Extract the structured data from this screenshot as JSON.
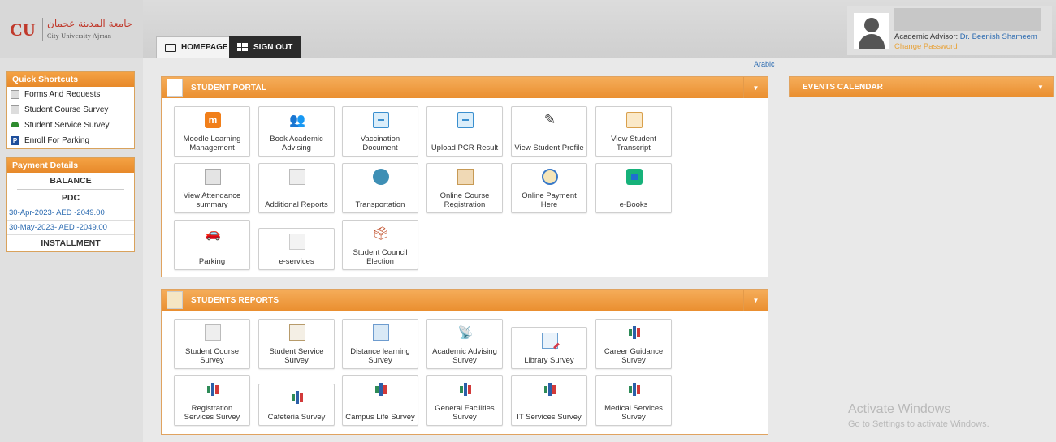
{
  "logo": {
    "abbr": "CU",
    "arabic": "جامعة المدينة عجمان",
    "english": "City University Ajman"
  },
  "tabs": [
    {
      "label": "HOMEPAGE",
      "icon": "monitor-icon"
    },
    {
      "label": "SIGN OUT",
      "icon": "grid-icon"
    }
  ],
  "user": {
    "role_prefix": "Academic Advisor:",
    "advisor": "Dr. Beenish Shameem",
    "change_password": "Change Password"
  },
  "language_link": "Arabic",
  "sidebar": {
    "quick_shortcuts": {
      "title": "Quick Shortcuts",
      "items": [
        {
          "label": "Forms And Requests",
          "icon": "document-icon"
        },
        {
          "label": "Student Course Survey",
          "icon": "survey-icon"
        },
        {
          "label": "Student Service Survey",
          "icon": "service-icon"
        },
        {
          "label": "Enroll For Parking",
          "icon": "parking-icon"
        }
      ]
    },
    "payment": {
      "title": "Payment Details",
      "balance": "BALANCE",
      "pdc": "PDC",
      "entries": [
        "30-Apr-2023- AED -2049.00",
        "30-May-2023- AED -2049.00"
      ],
      "installment": "INSTALLMENT"
    }
  },
  "student_portal": {
    "title": "STUDENT PORTAL",
    "tiles": [
      {
        "label": "Moodle Learning Management",
        "icon": "moodle-icon"
      },
      {
        "label": "Book Academic Advising",
        "icon": "advising-icon"
      },
      {
        "label": "Vaccination Document",
        "icon": "clipboard-icon"
      },
      {
        "label": "Upload PCR Result",
        "icon": "clipboard-icon"
      },
      {
        "label": "View Student Profile",
        "icon": "pencil-icon"
      },
      {
        "label": "View Student Transcript",
        "icon": "transcript-icon"
      },
      {
        "label": "View Attendance summary",
        "icon": "calendar-icon"
      },
      {
        "label": "Additional Reports",
        "icon": "envelope-icon"
      },
      {
        "label": "Transportation",
        "icon": "bus-icon"
      },
      {
        "label": "Online Course Registration",
        "icon": "book-icon"
      },
      {
        "label": "Online Payment Here",
        "icon": "payment-icon"
      },
      {
        "label": "e-Books",
        "icon": "ebook-icon"
      },
      {
        "label": "Parking",
        "icon": "car-icon"
      },
      {
        "label": "e-services",
        "icon": "chart-icon"
      },
      {
        "label": "Student Council Election",
        "icon": "ballot-icon"
      }
    ]
  },
  "students_reports": {
    "title": "STUDENTS REPORTS",
    "tiles": [
      {
        "label": "Student Course Survey",
        "icon": "document-icon"
      },
      {
        "label": "Student Service Survey",
        "icon": "calendar-icon"
      },
      {
        "label": "Distance learning Survey",
        "icon": "banner-icon"
      },
      {
        "label": "Academic Advising Survey",
        "icon": "satellite-icon"
      },
      {
        "label": "Library Survey",
        "icon": "note-icon"
      },
      {
        "label": "Career Guidance Survey",
        "icon": "bar-chart-icon"
      },
      {
        "label": "Registration Services Survey",
        "icon": "bar-chart-icon"
      },
      {
        "label": "Cafeteria Survey",
        "icon": "bar-chart-icon"
      },
      {
        "label": "Campus Life Survey",
        "icon": "bar-chart-icon"
      },
      {
        "label": "General Facilities Survey",
        "icon": "bar-chart-icon"
      },
      {
        "label": "IT Services Survey",
        "icon": "bar-chart-icon"
      },
      {
        "label": "Medical Services Survey",
        "icon": "bar-chart-icon"
      }
    ]
  },
  "events_calendar": {
    "title": "EVENTS CALENDAR"
  },
  "watermark": {
    "title": "Activate Windows",
    "subtitle": "Go to Settings to activate Windows."
  }
}
